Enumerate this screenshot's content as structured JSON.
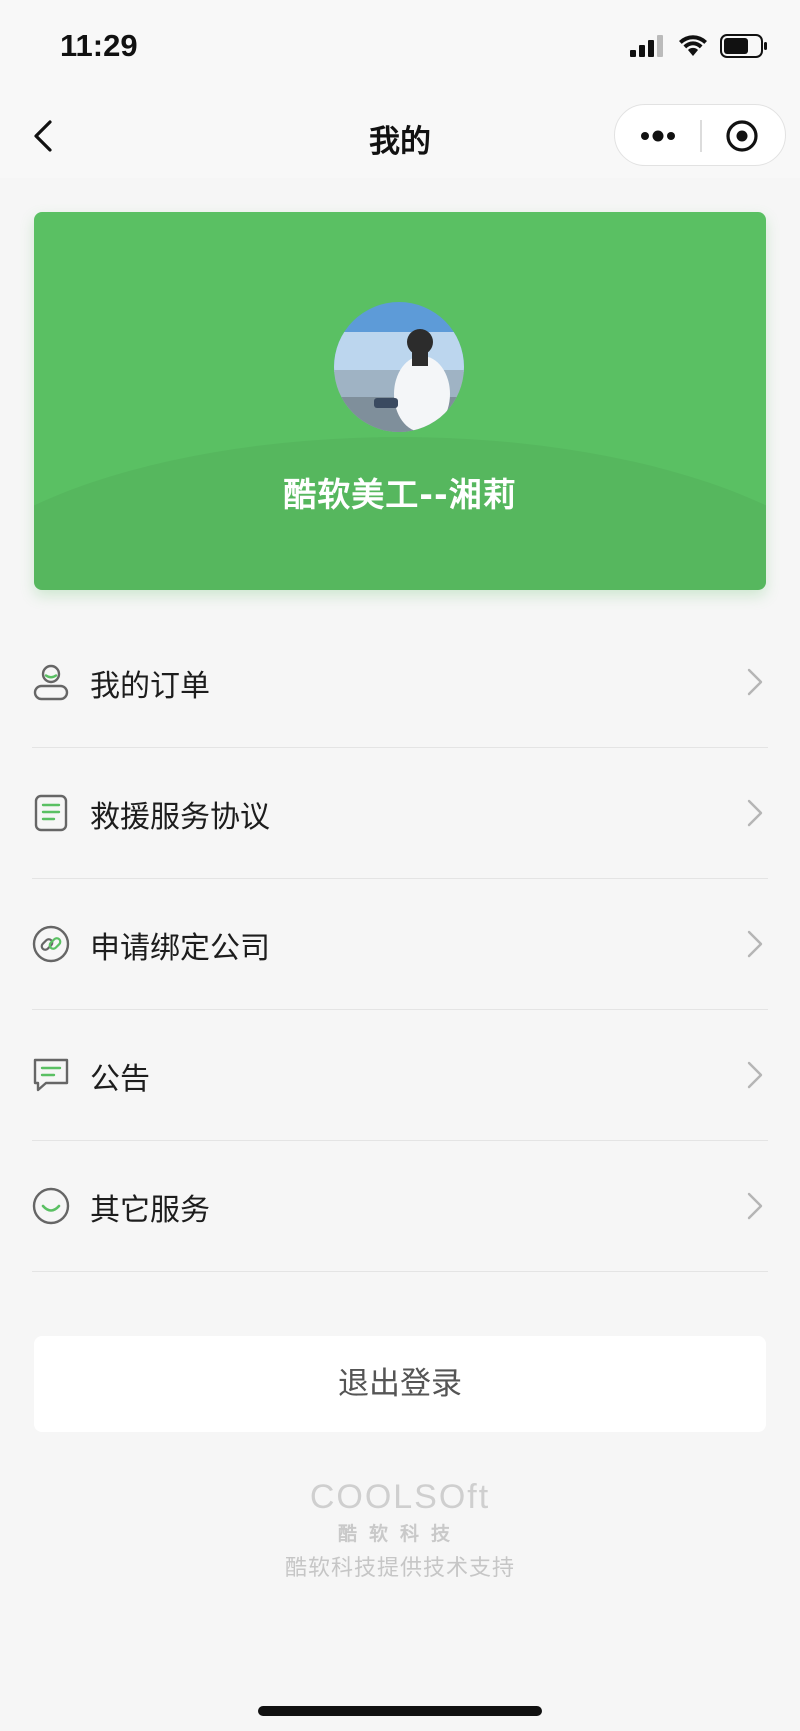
{
  "status_bar": {
    "time": "11:29"
  },
  "nav": {
    "title": "我的"
  },
  "profile": {
    "username": "酷软美工--湘莉"
  },
  "menu": {
    "items": [
      {
        "label": "我的订单",
        "icon": "user-icon"
      },
      {
        "label": "救援服务协议",
        "icon": "clipboard-icon"
      },
      {
        "label": "申请绑定公司",
        "icon": "link-icon"
      },
      {
        "label": "公告",
        "icon": "message-icon"
      },
      {
        "label": "其它服务",
        "icon": "smile-icon"
      }
    ]
  },
  "logout": {
    "label": "退出登录"
  },
  "footer": {
    "logo_text": "COOLSOft",
    "brand_cn": "酷软科技",
    "support": "酷软科技提供技术支持"
  },
  "colors": {
    "accent": "#5ac063",
    "background": "#f6f6f6"
  }
}
